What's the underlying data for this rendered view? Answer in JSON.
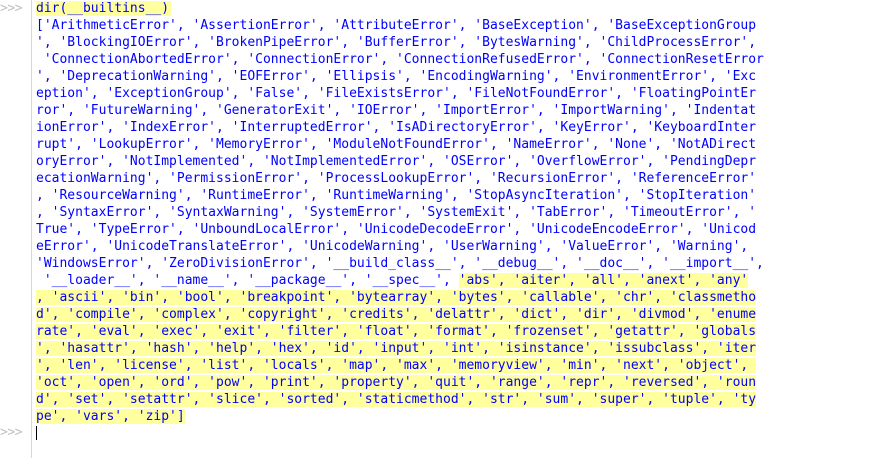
{
  "shell": {
    "prompt": ">>>",
    "input": "dir(__builtins__)",
    "output_lines": [
      "['ArithmeticError', 'AssertionError', 'AttributeError', 'BaseException', 'BaseExceptionGroup",
      "', 'BlockingIOError', 'BrokenPipeError', 'BufferError', 'BytesWarning', 'ChildProcessError',",
      " 'ConnectionAbortedError', 'ConnectionError', 'ConnectionRefusedError', 'ConnectionResetError",
      "', 'DeprecationWarning', 'EOFError', 'Ellipsis', 'EncodingWarning', 'EnvironmentError', 'Exc",
      "eption', 'ExceptionGroup', 'False', 'FileExistsError', 'FileNotFoundError', 'FloatingPointEr",
      "ror', 'FutureWarning', 'GeneratorExit', 'IOError', 'ImportError', 'ImportWarning', 'Indentat",
      "ionError', 'IndexError', 'InterruptedError', 'IsADirectoryError', 'KeyError', 'KeyboardInter",
      "rupt', 'LookupError', 'MemoryError', 'ModuleNotFoundError', 'NameError', 'None', 'NotADirect",
      "oryError', 'NotImplemented', 'NotImplementedError', 'OSError', 'OverflowError', 'PendingDepr",
      "ecationWarning', 'PermissionError', 'ProcessLookupError', 'RecursionError', 'ReferenceError'",
      ", 'ResourceWarning', 'RuntimeError', 'RuntimeWarning', 'StopAsyncIteration', 'StopIteration'",
      ", 'SyntaxError', 'SyntaxWarning', 'SystemError', 'SystemExit', 'TabError', 'TimeoutError', '",
      "True', 'TypeError', 'UnboundLocalError', 'UnicodeDecodeError', 'UnicodeEncodeError', 'Unicod",
      "eError', 'UnicodeTranslateError', 'UnicodeWarning', 'UserWarning', 'ValueError', 'Warning', ",
      "'WindowsError', 'ZeroDivisionError', '__build_class__', '__debug__', '__doc__', '__import__',",
      " '__loader__', '__name__', '__package__', '__spec__', 'abs', 'aiter', 'all', 'anext', 'any'",
      ", 'ascii', 'bin', 'bool', 'breakpoint', 'bytearray', 'bytes', 'callable', 'chr', 'classmetho",
      "d', 'compile', 'complex', 'copyright', 'credits', 'delattr', 'dict', 'dir', 'divmod', 'enume",
      "rate', 'eval', 'exec', 'exit', 'filter', 'float', 'format', 'frozenset', 'getattr', 'globals",
      "', 'hasattr', 'hash', 'help', 'hex', 'id', 'input', 'int', 'isinstance', 'issubclass', 'iter",
      "', 'len', 'license', 'list', 'locals', 'map', 'max', 'memoryview', 'min', 'next', 'object', ",
      "'oct', 'open', 'ord', 'pow', 'print', 'property', 'quit', 'range', 'repr', 'reversed', 'roun",
      "d', 'set', 'setattr', 'slice', 'sorted', 'staticmethod', 'str', 'sum', 'super', 'tuple', 'ty",
      "pe', 'vars', 'zip']"
    ],
    "line15_plain": " '__loader__', '__name__', '__package__', '__spec__', ",
    "line15_highlight": "'abs', 'aiter', 'all', 'anext', 'any'"
  }
}
